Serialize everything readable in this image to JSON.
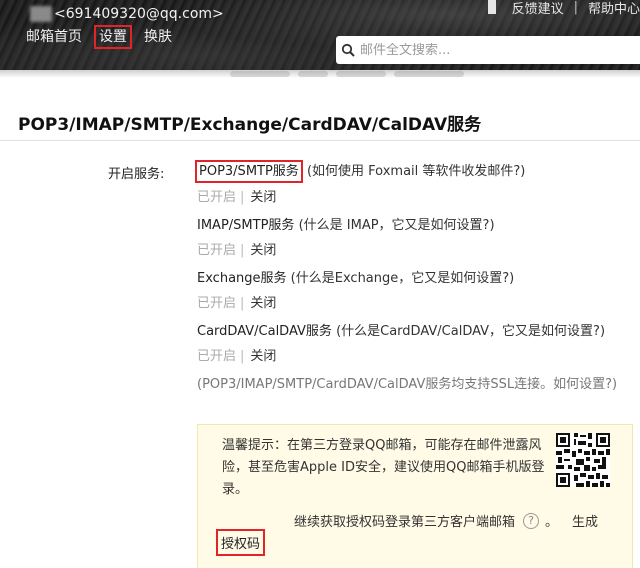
{
  "header": {
    "account": "<691409320@qq.com>",
    "top_links": [
      "反馈建议",
      "帮助中心"
    ],
    "nav": [
      {
        "label": "邮箱首页"
      },
      {
        "label": "设置"
      },
      {
        "label": "换肤"
      }
    ],
    "search": {
      "placeholder": "邮件全文搜索..."
    }
  },
  "section": {
    "title": "POP3/IMAP/SMTP/Exchange/CardDAV/CalDAV服务",
    "label": "开启服务:",
    "services": [
      {
        "name": "POP3/SMTP服务",
        "question": "(如何使用 Foxmail 等软件收发邮件?)",
        "status_on": "已开启",
        "status_off": "关闭"
      },
      {
        "name": "IMAP/SMTP服务",
        "question": "(什么是 IMAP，它又是如何设置?)",
        "status_on": "已开启",
        "status_off": "关闭"
      },
      {
        "name": "Exchange服务",
        "question": "(什么是Exchange，它又是如何设置?)",
        "status_on": "已开启",
        "status_off": "关闭"
      },
      {
        "name": "CardDAV/CalDAV服务",
        "question": "(什么是CardDAV/CalDAV，它又是如何设置?)",
        "status_on": "已开启",
        "status_off": "关闭"
      }
    ],
    "ssl_note": "(POP3/IMAP/SMTP/CardDAV/CalDAV服务均支持SSL连接。如何设置?)",
    "separator": "|"
  },
  "tip": {
    "text": "温馨提示：在第三方登录QQ邮箱，可能存在邮件泄露风险，甚至危害Apple ID安全，建议使用QQ邮箱手机版登录。",
    "line2": "继续获取授权码登录第三方客户端邮箱",
    "help": "?",
    "period": "。",
    "generate": "生成",
    "auth_code": "授权码"
  },
  "colors": {
    "highlight_box": "#e0242a",
    "tip_bg": "#fffbe6"
  }
}
